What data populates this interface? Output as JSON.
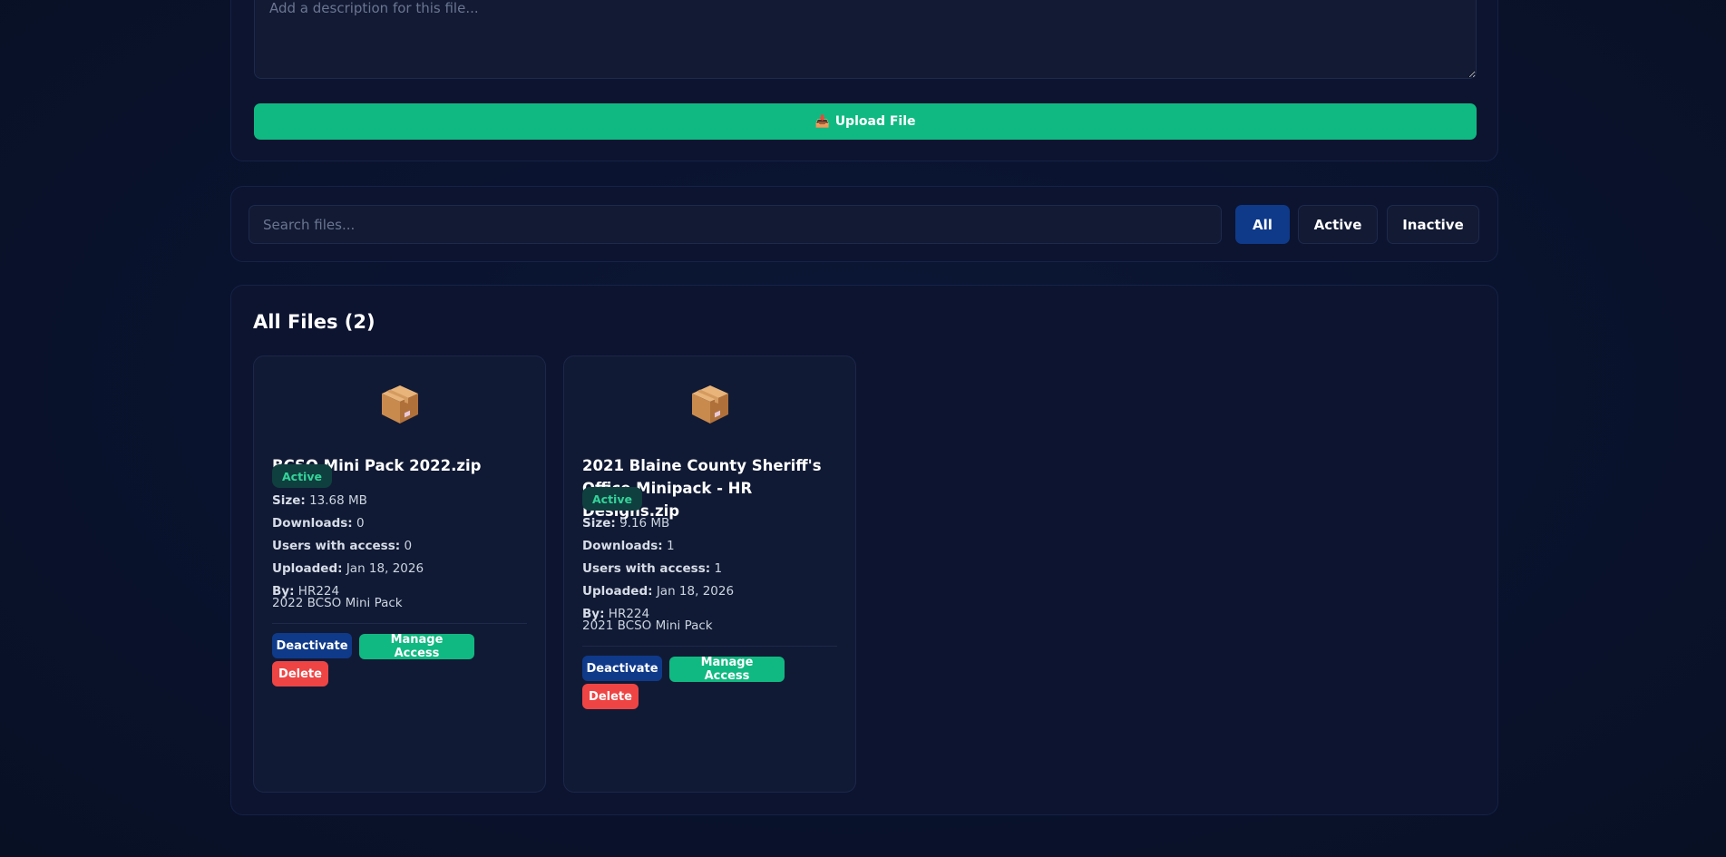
{
  "upload": {
    "description_placeholder": "Add a description for this file...",
    "upload_label": "Upload File",
    "upload_icon": "inbox-upload-icon"
  },
  "search": {
    "placeholder": "Search files...",
    "filters": [
      {
        "label": "All",
        "selected": true
      },
      {
        "label": "Active",
        "selected": false
      },
      {
        "label": "Inactive",
        "selected": false
      }
    ]
  },
  "files": {
    "title": "All Files (2)",
    "items": [
      {
        "icon": "package-icon",
        "name": "BCSO Mini Pack 2022.zip",
        "status": "Active",
        "size_label": "Size:",
        "size": "13.68 MB",
        "downloads_label": "Downloads:",
        "downloads": "0",
        "users_label": "Users with access:",
        "users": "0",
        "uploaded_label": "Uploaded:",
        "uploaded": "Jan 18, 2026",
        "by_label": "By:",
        "by": "HR224",
        "description": "2022 BCSO Mini Pack",
        "deactivate_label": "Deactivate",
        "manage_label": "Manage Access",
        "delete_label": "Delete"
      },
      {
        "icon": "package-icon",
        "name": "2021 Blaine County Sheriff's Office Minipack - HR Designs.zip",
        "status": "Active",
        "size_label": "Size:",
        "size": "9.16 MB",
        "downloads_label": "Downloads:",
        "downloads": "1",
        "users_label": "Users with access:",
        "users": "1",
        "uploaded_label": "Uploaded:",
        "uploaded": "Jan 18, 2026",
        "by_label": "By:",
        "by": "HR224",
        "description": "2021 BCSO Mini Pack",
        "deactivate_label": "Deactivate",
        "manage_label": "Manage Access",
        "delete_label": "Delete"
      }
    ]
  },
  "colors": {
    "accent_blue": "#0f3a8a",
    "accent_green": "#10b981",
    "danger_red": "#ef4444",
    "status_active_text": "#34d399"
  }
}
